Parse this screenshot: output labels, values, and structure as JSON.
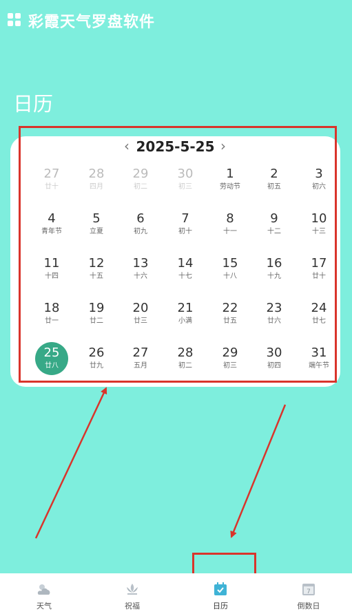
{
  "app": {
    "title": "彩霞天气罗盘软件"
  },
  "page": {
    "title": "日历"
  },
  "calendar": {
    "date_label": "2025-5-25",
    "selected_day": "25",
    "rows": [
      [
        {
          "day": "27",
          "lunar": "廿十",
          "muted": true
        },
        {
          "day": "28",
          "lunar": "四月",
          "muted": true
        },
        {
          "day": "29",
          "lunar": "初二",
          "muted": true
        },
        {
          "day": "30",
          "lunar": "初三",
          "muted": true
        },
        {
          "day": "1",
          "lunar": "劳动节",
          "muted": false
        },
        {
          "day": "2",
          "lunar": "初五",
          "muted": false
        },
        {
          "day": "3",
          "lunar": "初六",
          "muted": false
        }
      ],
      [
        {
          "day": "4",
          "lunar": "青年节",
          "muted": false
        },
        {
          "day": "5",
          "lunar": "立夏",
          "muted": false
        },
        {
          "day": "6",
          "lunar": "初九",
          "muted": false
        },
        {
          "day": "7",
          "lunar": "初十",
          "muted": false
        },
        {
          "day": "8",
          "lunar": "十一",
          "muted": false
        },
        {
          "day": "9",
          "lunar": "十二",
          "muted": false
        },
        {
          "day": "10",
          "lunar": "十三",
          "muted": false
        }
      ],
      [
        {
          "day": "11",
          "lunar": "十四",
          "muted": false
        },
        {
          "day": "12",
          "lunar": "十五",
          "muted": false
        },
        {
          "day": "13",
          "lunar": "十六",
          "muted": false
        },
        {
          "day": "14",
          "lunar": "十七",
          "muted": false
        },
        {
          "day": "15",
          "lunar": "十八",
          "muted": false
        },
        {
          "day": "16",
          "lunar": "十九",
          "muted": false
        },
        {
          "day": "17",
          "lunar": "廿十",
          "muted": false
        }
      ],
      [
        {
          "day": "18",
          "lunar": "廿一",
          "muted": false
        },
        {
          "day": "19",
          "lunar": "廿二",
          "muted": false
        },
        {
          "day": "20",
          "lunar": "廿三",
          "muted": false
        },
        {
          "day": "21",
          "lunar": "小满",
          "muted": false
        },
        {
          "day": "22",
          "lunar": "廿五",
          "muted": false
        },
        {
          "day": "23",
          "lunar": "廿六",
          "muted": false
        },
        {
          "day": "24",
          "lunar": "廿七",
          "muted": false
        }
      ],
      [
        {
          "day": "25",
          "lunar": "廿八",
          "muted": false
        },
        {
          "day": "26",
          "lunar": "廿九",
          "muted": false
        },
        {
          "day": "27",
          "lunar": "五月",
          "muted": false
        },
        {
          "day": "28",
          "lunar": "初二",
          "muted": false
        },
        {
          "day": "29",
          "lunar": "初三",
          "muted": false
        },
        {
          "day": "30",
          "lunar": "初四",
          "muted": false
        },
        {
          "day": "31",
          "lunar": "端午节",
          "muted": false
        }
      ]
    ]
  },
  "bottom_nav": [
    {
      "label": "天气",
      "icon": "weather-icon",
      "active": false
    },
    {
      "label": "祝福",
      "icon": "lotus-icon",
      "active": false
    },
    {
      "label": "日历",
      "icon": "calendar-check-icon",
      "active": true
    },
    {
      "label": "倒数日",
      "icon": "countdown-calendar-icon",
      "active": false
    }
  ],
  "colors": {
    "background": "#7eeedd",
    "selected": "#37a987",
    "annotation": "#d9342b",
    "active_tab_icon": "#3fb3d6"
  }
}
